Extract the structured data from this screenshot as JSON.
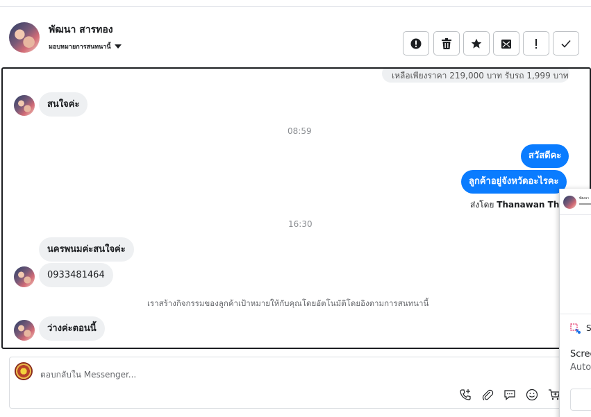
{
  "header": {
    "contact_name": "พัฒนา สารทอง",
    "assign_label": "มอบหมายการสนทนานี้",
    "actions": [
      {
        "name": "report-button",
        "icon": "alert-circle-icon"
      },
      {
        "name": "delete-button",
        "icon": "trash-icon"
      },
      {
        "name": "star-button",
        "icon": "star-icon"
      },
      {
        "name": "mark-unread-button",
        "icon": "envelope-icon"
      },
      {
        "name": "important-button",
        "icon": "exclamation-icon"
      },
      {
        "name": "done-button",
        "icon": "check-icon"
      }
    ]
  },
  "conversation": {
    "truncated_message": "เหลือเพียงราคา 219,000 บาท รับรถ 1,999 บาท",
    "messages": [
      {
        "from": "customer",
        "text": "สนใจค่ะ"
      },
      {
        "time": "08:59"
      },
      {
        "from": "page",
        "text": "สวัสดีคะ"
      },
      {
        "from": "page",
        "text": "ลูกค้าอยู่จังหวัดอะไรคะ"
      },
      {
        "time": "16:30"
      },
      {
        "from": "customer",
        "text": "นครพนมค่ะสนใจค่ะ"
      },
      {
        "from": "customer",
        "text": "0933481464"
      },
      {
        "from": "customer",
        "text": "ว่างค่ะตอนนี้"
      }
    ],
    "sent_by_prefix": "ส่งโดย",
    "sent_by_name": "Thanawan Thon",
    "system_note": "เราสร้างกิจกรรมของลูกค้าเป้าหมายให้กับคุณโดยอัตโนมัติโดยอิงตามการสนทนานี้"
  },
  "composer": {
    "placeholder": "ตอบกลับใน Messenger...",
    "icons": [
      "add-call-icon",
      "paperclip-icon",
      "saved-replies-icon",
      "emoji-icon",
      "cart-icon"
    ]
  },
  "side_panel": {
    "tiny_text": "พัฒนา",
    "s_label": "S",
    "line1": "Scree",
    "line2": "Auto"
  },
  "colors": {
    "outgoing_bubble": "#0a7cff",
    "incoming_bubble": "#eef0f2",
    "border": "#1c1e21"
  }
}
